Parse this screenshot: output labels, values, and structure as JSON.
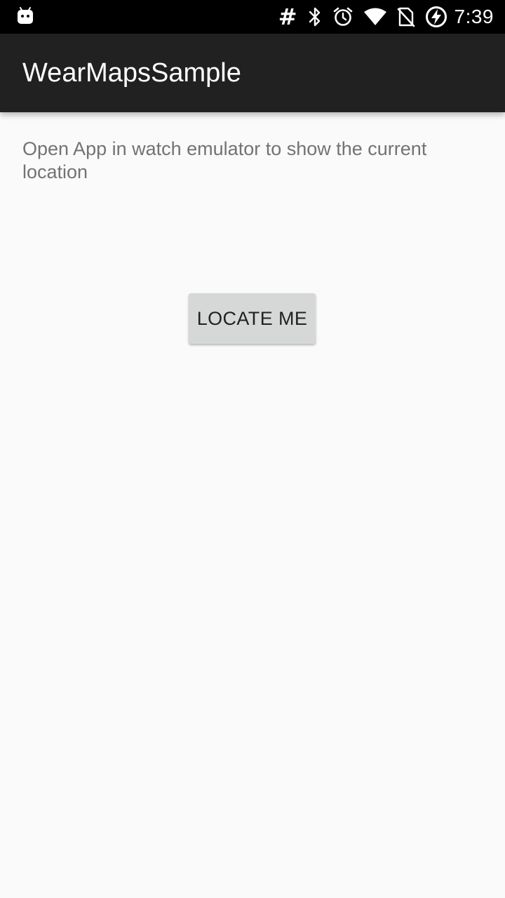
{
  "status_bar": {
    "time": "7:39",
    "icons": [
      "android-notification-icon",
      "hash-icon",
      "bluetooth-icon",
      "alarm-icon",
      "wifi-icon",
      "no-sim-icon",
      "battery-charging-icon"
    ],
    "hash_glyph": "#"
  },
  "app_bar": {
    "title": "WearMapsSample"
  },
  "main": {
    "hint": "Open App in watch emulator to show the current location",
    "locate_button_label": "LOCATE ME"
  },
  "colors": {
    "status_bar": "#000000",
    "app_bar": "#212121",
    "background": "#fafafa",
    "hint_text": "#737373",
    "button_bg": "#d6d7d7",
    "button_text": "#212121"
  }
}
